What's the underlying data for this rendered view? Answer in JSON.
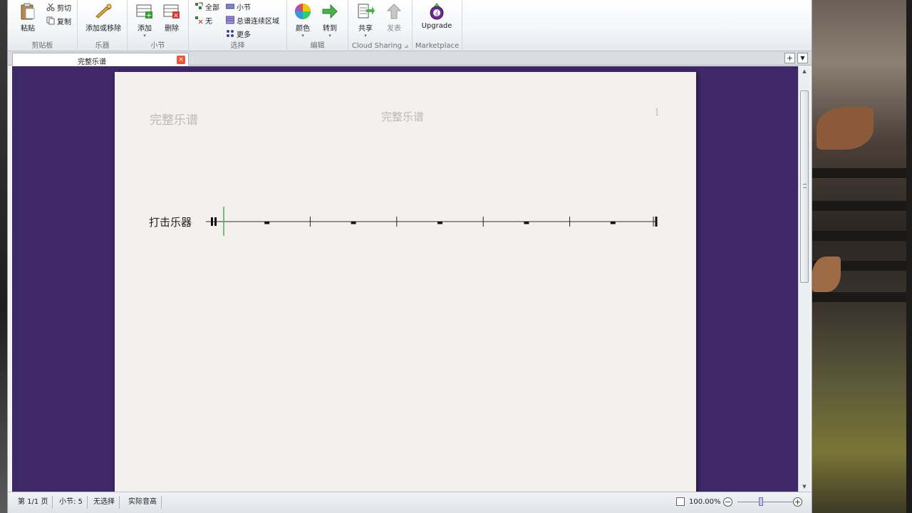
{
  "ribbon": {
    "clipboard": {
      "label": "剪贴板",
      "paste": "粘贴",
      "cut": "剪切",
      "copy": "复制"
    },
    "instruments": {
      "label": "乐器",
      "add_remove": "添加或移除"
    },
    "bars": {
      "label": "小节",
      "add": "添加",
      "delete": "删除"
    },
    "select": {
      "label": "选择",
      "all": "全部",
      "none": "无",
      "bar": "小节",
      "system_passage": "总谱连续区域",
      "more": "更多"
    },
    "edit": {
      "label": "编辑",
      "color": "颜色",
      "goto": "转到"
    },
    "cloud": {
      "label": "Cloud Sharing",
      "share": "共享",
      "publish": "发表"
    },
    "marketplace": {
      "label": "Marketplace",
      "upgrade": "Upgrade"
    }
  },
  "tab": {
    "title": "完整乐谱",
    "close": "×"
  },
  "tabbar_buttons": {
    "add": "+",
    "menu": "▼"
  },
  "score": {
    "header_left": "完整乐谱",
    "header_center": "完整乐谱",
    "page_number": "1",
    "instrument_name": "打击乐器",
    "bar_count": 5
  },
  "statusbar": {
    "page": "第 1/1 页",
    "bars": "小节: 5",
    "selection": "无选择",
    "pitch": "实际音高",
    "zoom": "100.00%",
    "zoom_minus": "−",
    "zoom_plus": "+"
  },
  "zoom_fraction": 0.5,
  "colors": {
    "score_background": "#3e2866",
    "paper": "#f3f0ed",
    "accent_green": "#4caf50"
  },
  "icons": [
    "paste-icon",
    "cut-icon",
    "copy-icon",
    "trumpet-icon",
    "add-bar-icon",
    "delete-bar-icon",
    "select-all-icon",
    "select-none-icon",
    "select-bar-icon",
    "select-passage-icon",
    "select-more-icon",
    "color-wheel-icon",
    "goto-arrow-icon",
    "share-icon",
    "publish-icon",
    "upgrade-icon"
  ]
}
